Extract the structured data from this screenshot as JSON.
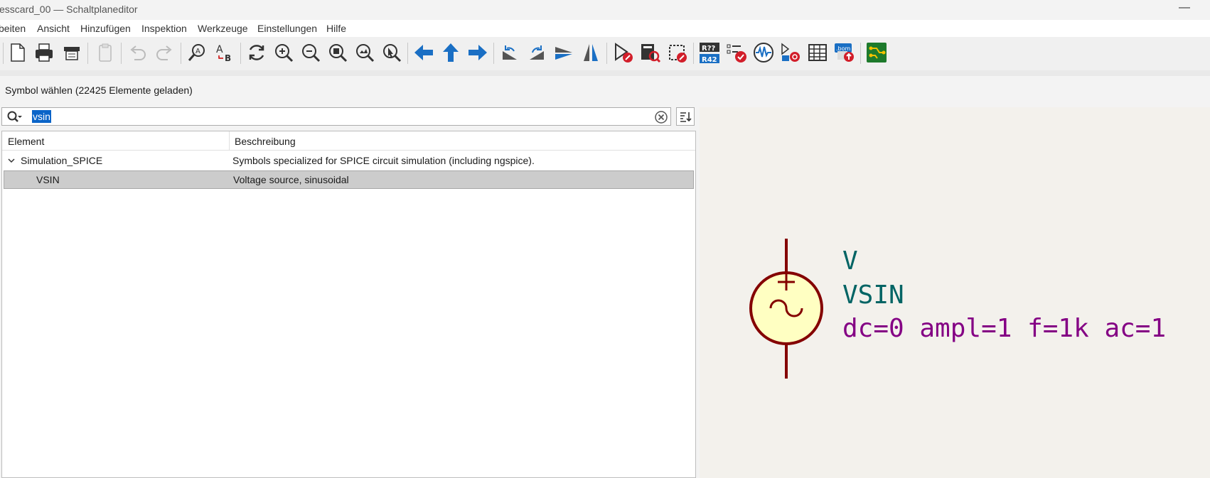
{
  "window": {
    "title": "esscard_00 — Schaltplaneditor",
    "minimize_glyph": "—"
  },
  "menu": [
    "beiten",
    "Ansicht",
    "Hinzufügen",
    "Inspektion",
    "Werkzeuge",
    "Einstellungen",
    "Hilfe"
  ],
  "toolbar": {
    "icons": [
      "page-settings-icon",
      "print-icon",
      "plot-icon",
      "paste-icon",
      "undo-icon",
      "redo-icon",
      "find-icon",
      "find-replace-icon",
      "refresh-icon",
      "zoom-in-icon",
      "zoom-out-icon",
      "zoom-fit-icon",
      "zoom-objects-icon",
      "zoom-selection-icon",
      "arrow-left-icon",
      "arrow-up-icon",
      "arrow-right-icon",
      "rotate-ccw-icon",
      "rotate-cw-icon",
      "mirror-vertical-icon",
      "mirror-horizontal-icon",
      "symbol-editor-icon",
      "symbol-browser-icon",
      "footprint-editor-icon",
      "annotate-icon",
      "erc-icon",
      "simulator-icon",
      "assign-footprints-icon",
      "fields-table-icon",
      "bom-icon",
      "pcb-editor-icon"
    ]
  },
  "dialog": {
    "title": "Symbol wählen (22425 Elemente geladen)"
  },
  "search": {
    "value": "vsin",
    "placeholder": ""
  },
  "tree": {
    "columns": [
      "Element",
      "Beschreibung"
    ],
    "rows": [
      {
        "name": "Simulation_SPICE",
        "description": "Symbols specialized for SPICE circuit simulation (including ngspice).",
        "expanded": true,
        "level": 0
      },
      {
        "name": "VSIN",
        "description": "Voltage source, sinusoidal",
        "selected": true,
        "level": 1
      }
    ]
  },
  "preview": {
    "reference": "V",
    "value": "VSIN",
    "parameters": "dc=0 ampl=1 f=1k ac=1",
    "colors": {
      "body_fill": "#ffffc2",
      "outline": "#840000",
      "field_text": "#006464",
      "param_text": "#840084",
      "background": "#f3f1ec"
    }
  }
}
